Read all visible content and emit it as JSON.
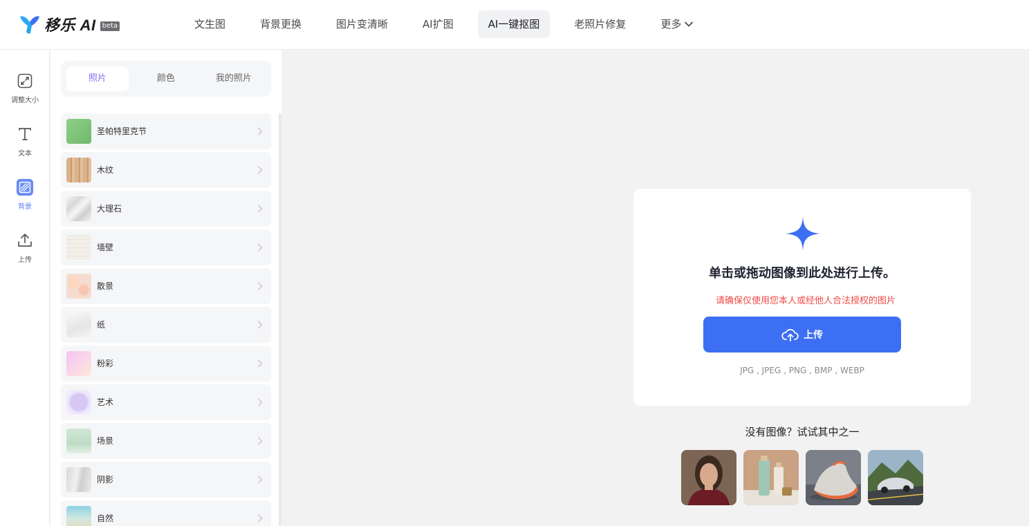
{
  "header": {
    "logo_text": "移乐 AI",
    "logo_badge": "beta",
    "nav": [
      {
        "label": "文生图"
      },
      {
        "label": "背景更换"
      },
      {
        "label": "图片变清晰"
      },
      {
        "label": "AI扩图"
      },
      {
        "label": "AI一键抠图",
        "active": true
      },
      {
        "label": "老照片修复"
      },
      {
        "label": "更多",
        "icon": "chevron-down-icon"
      }
    ]
  },
  "rail": [
    {
      "label": "调整大小",
      "icon": "resize-icon"
    },
    {
      "label": "文本",
      "icon": "text-icon"
    },
    {
      "label": "背景",
      "icon": "background-icon",
      "active": true
    },
    {
      "label": "上传",
      "icon": "upload-icon"
    }
  ],
  "panel": {
    "tabs": [
      "照片",
      "颜色",
      "我的照片"
    ],
    "active_tab": "照片",
    "items": [
      {
        "label": "圣帕特里克节",
        "icon": "chevron-right-icon"
      },
      {
        "label": "木纹",
        "icon": "chevron-right-icon"
      },
      {
        "label": "大理石",
        "icon": "chevron-right-icon"
      },
      {
        "label": "墙壁",
        "icon": "chevron-right-icon"
      },
      {
        "label": "散景",
        "icon": "chevron-right-icon"
      },
      {
        "label": "纸",
        "icon": "chevron-right-icon"
      },
      {
        "label": "粉彩",
        "icon": "chevron-right-icon"
      },
      {
        "label": "艺术",
        "icon": "chevron-right-icon"
      },
      {
        "label": "场景",
        "icon": "chevron-right-icon"
      },
      {
        "label": "阴影",
        "icon": "chevron-right-icon"
      },
      {
        "label": "自然",
        "icon": "chevron-right-icon"
      }
    ]
  },
  "upload": {
    "icon": "sparkle-plus-icon",
    "title": "单击或拖动图像到此处进行上传。",
    "warning": "请确保仅使用您本人或经他人合法授权的图片",
    "button_label": "上传",
    "button_icon": "cloud-upload-icon",
    "formats": "JPG , JPEG , PNG , BMP , WEBP"
  },
  "samples": {
    "title": "没有图像？试试其中之一"
  },
  "colors": {
    "accent_blue": "#3c6ff4",
    "active_tab_purple": "#8b6cf0",
    "warning_red": "#f04a45"
  }
}
